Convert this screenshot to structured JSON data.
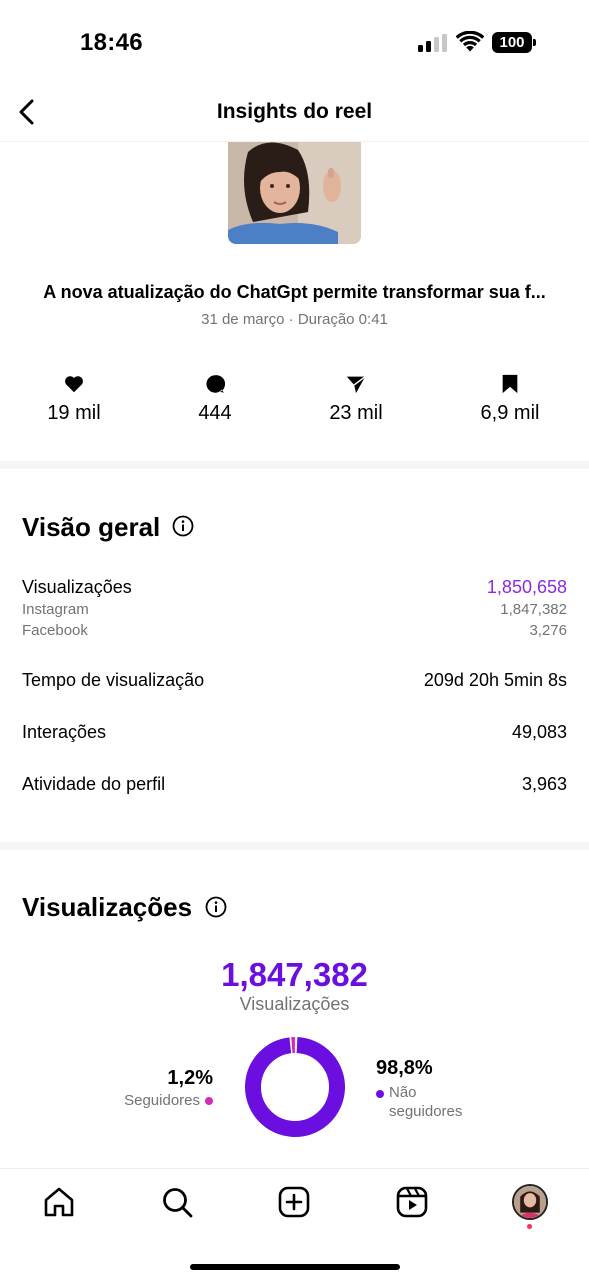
{
  "status_bar": {
    "time": "18:46",
    "battery": "100"
  },
  "header": {
    "title": "Insights do reel"
  },
  "reel": {
    "title": "A nova atualização do ChatGpt permite transformar sua f...",
    "meta": "31 de março · Duração 0:41"
  },
  "engagement": {
    "likes": "19 mil",
    "comments": "444",
    "shares": "23 mil",
    "saves": "6,9 mil"
  },
  "overview": {
    "title": "Visão geral",
    "views_label": "Visualizações",
    "views_value": "1,850,658",
    "instagram_label": "Instagram",
    "instagram_value": "1,847,382",
    "facebook_label": "Facebook",
    "facebook_value": "3,276",
    "watch_time_label": "Tempo de visualização",
    "watch_time_value": "209d 20h 5min 8s",
    "interactions_label": "Interações",
    "interactions_value": "49,083",
    "profile_activity_label": "Atividade do perfil",
    "profile_activity_value": "3,963"
  },
  "views": {
    "title": "Visualizações",
    "total": "1,847,382",
    "caption": "Visualizações",
    "followers_pct": "1,2%",
    "followers_label": "Seguidores",
    "non_followers_pct": "98,8%",
    "non_followers_label_line1": "Não",
    "non_followers_label_line2": "seguidores",
    "followers_fraction": 0.012,
    "colors": {
      "followers": "#d42ab8",
      "non_followers": "#6a0fe0",
      "accent": "#8a2be2"
    }
  },
  "icons": {
    "back": "chevron-left-icon",
    "like": "heart-icon",
    "comment": "comment-bubble-icon",
    "share": "paper-plane-icon",
    "save": "bookmark-icon",
    "info": "info-circle-icon",
    "nav": [
      "home-icon",
      "search-icon",
      "create-plus-icon",
      "reels-icon",
      "profile-avatar"
    ]
  }
}
